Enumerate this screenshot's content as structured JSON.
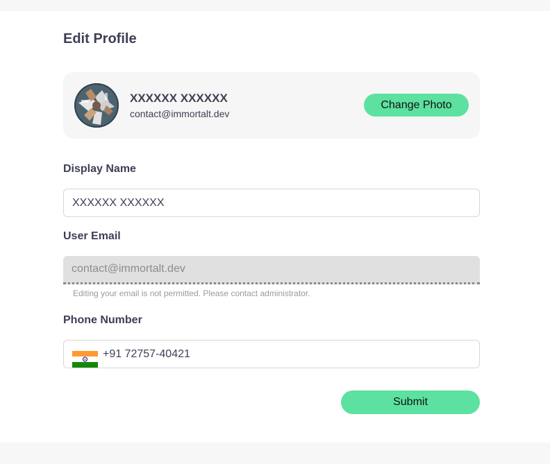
{
  "page": {
    "title": "Edit Profile"
  },
  "profile": {
    "name": "XXXXXX XXXXXX",
    "email": "contact@immortalt.dev",
    "change_photo_label": "Change Photo",
    "avatar_icon": "avatar-photo"
  },
  "form": {
    "display_name_label": "Display Name",
    "display_name_value": "XXXXXX XXXXXX",
    "user_email_label": "User Email",
    "user_email_value": "contact@immortalt.dev",
    "email_helper": "Editing your email is not permitted. Please contact administrator.",
    "phone_label": "Phone Number",
    "phone_value": "+91 72757-40421",
    "phone_country_flag": "india-flag-icon",
    "submit_label": "Submit"
  },
  "colors": {
    "accent": "#5ce1a0",
    "text": "#3d3f55",
    "disabled_bg": "#e0e0e0",
    "helper_text": "#9a9a9a"
  }
}
